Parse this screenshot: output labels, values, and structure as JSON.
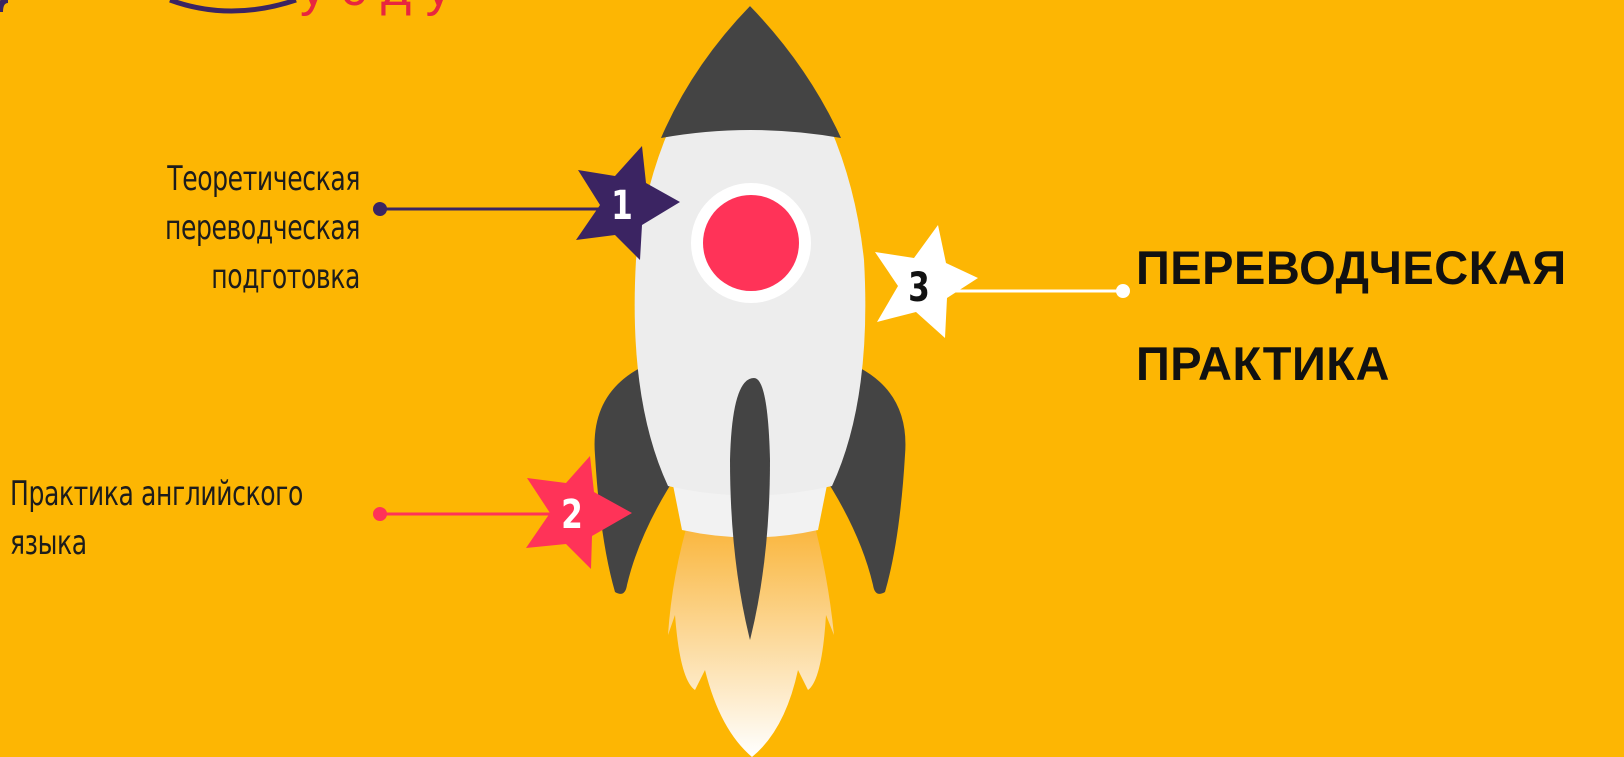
{
  "header": {
    "title_fragment": "у с      д      у"
  },
  "steps": [
    {
      "number": "1",
      "lines": [
        "Теоретическая",
        "переводческая",
        "подготовка"
      ],
      "color": "#3B2462"
    },
    {
      "number": "2",
      "lines": [
        "Практика английского",
        "языка"
      ],
      "color": "#FF3358"
    },
    {
      "number": "3",
      "lines": [
        "ПЕРЕВОДЧЕСКАЯ",
        "ПРАКТИКА"
      ],
      "color": "#FFFFFF"
    }
  ],
  "colors": {
    "background": "#FDB603",
    "rocket_body": "#EDEDED",
    "rocket_dark": "#444444",
    "window": "#FF3358",
    "title_red": "#E8263F"
  },
  "icons": [
    "rocket-icon",
    "star-badge-icon",
    "flame-icon"
  ]
}
